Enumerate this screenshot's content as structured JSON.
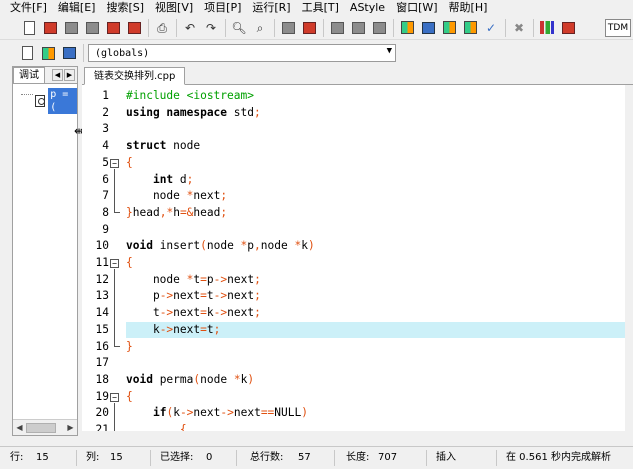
{
  "menu": [
    "文件[F]",
    "编辑[E]",
    "搜索[S]",
    "视图[V]",
    "项目[P]",
    "运行[R]",
    "工具[T]",
    "AStyle",
    "窗口[W]",
    "帮助[H]"
  ],
  "toolbar": {
    "scope_combo": "(globals)",
    "tdm_label": "TDM"
  },
  "left_panel": {
    "tab_label": "调试",
    "watch_item": "p = ("
  },
  "editor": {
    "tab_label": "链表交换排列.cpp",
    "current_line": 15,
    "lines": [
      {
        "n": "1",
        "html": "<span class=\"pp\">#include &lt;iostream&gt;</span>"
      },
      {
        "n": "2",
        "html": "<span class=\"kw\">using namespace</span> std<span class=\"op\">;</span>"
      },
      {
        "n": "3",
        "html": ""
      },
      {
        "n": "4",
        "html": "<span class=\"kw\">struct</span> node"
      },
      {
        "n": "5",
        "html": "<span class=\"op\">{</span>"
      },
      {
        "n": "6",
        "html": "    <span class=\"kw\">int</span> d<span class=\"op\">;</span>"
      },
      {
        "n": "7",
        "html": "    node <span class=\"op\">*</span>next<span class=\"op\">;</span>"
      },
      {
        "n": "8",
        "html": "<span class=\"op\">}</span>head<span class=\"op\">,*</span>h<span class=\"op\">=&amp;</span>head<span class=\"op\">;</span>"
      },
      {
        "n": "9",
        "html": ""
      },
      {
        "n": "10",
        "html": "<span class=\"kw\">void</span> insert<span class=\"op\">(</span>node <span class=\"op\">*</span>p<span class=\"op\">,</span>node <span class=\"op\">*</span>k<span class=\"op\">)</span>"
      },
      {
        "n": "11",
        "html": "<span class=\"op\">{</span>"
      },
      {
        "n": "12",
        "html": "    node <span class=\"op\">*</span>t<span class=\"op\">=</span>p<span class=\"op\">-&gt;</span>next<span class=\"op\">;</span>"
      },
      {
        "n": "13",
        "html": "    p<span class=\"op\">-&gt;</span>next<span class=\"op\">=</span>t<span class=\"op\">-&gt;</span>next<span class=\"op\">;</span>"
      },
      {
        "n": "14",
        "html": "    t<span class=\"op\">-&gt;</span>next<span class=\"op\">=</span>k<span class=\"op\">-&gt;</span>next<span class=\"op\">;</span>"
      },
      {
        "n": "15",
        "html": "    k<span class=\"op\">-&gt;</span>next<span class=\"op\">=</span>t<span class=\"op\">;</span>"
      },
      {
        "n": "16",
        "html": "<span class=\"op\">}</span>"
      },
      {
        "n": "17",
        "html": ""
      },
      {
        "n": "18",
        "html": "<span class=\"kw\">void</span> perma<span class=\"op\">(</span>node <span class=\"op\">*</span>k<span class=\"op\">)</span>"
      },
      {
        "n": "19",
        "html": "<span class=\"op\">{</span>"
      },
      {
        "n": "20",
        "html": "    <span class=\"kw\">if</span><span class=\"op\">(</span>k<span class=\"op\">-&gt;</span>next<span class=\"op\">-&gt;</span>next<span class=\"op\">==</span>NULL<span class=\"op\">)</span>"
      },
      {
        "n": "21",
        "html": "        <span class=\"op\">{</span>"
      }
    ]
  },
  "status": {
    "row_label": "行:",
    "row": "15",
    "col_label": "列:",
    "col": "15",
    "sel_label": "已选择:",
    "sel": "0",
    "total_label": "总行数:",
    "total": "57",
    "len_label": "长度:",
    "len": "707",
    "mode": "插入",
    "parse": "在 0.561 秒内完成解析"
  }
}
